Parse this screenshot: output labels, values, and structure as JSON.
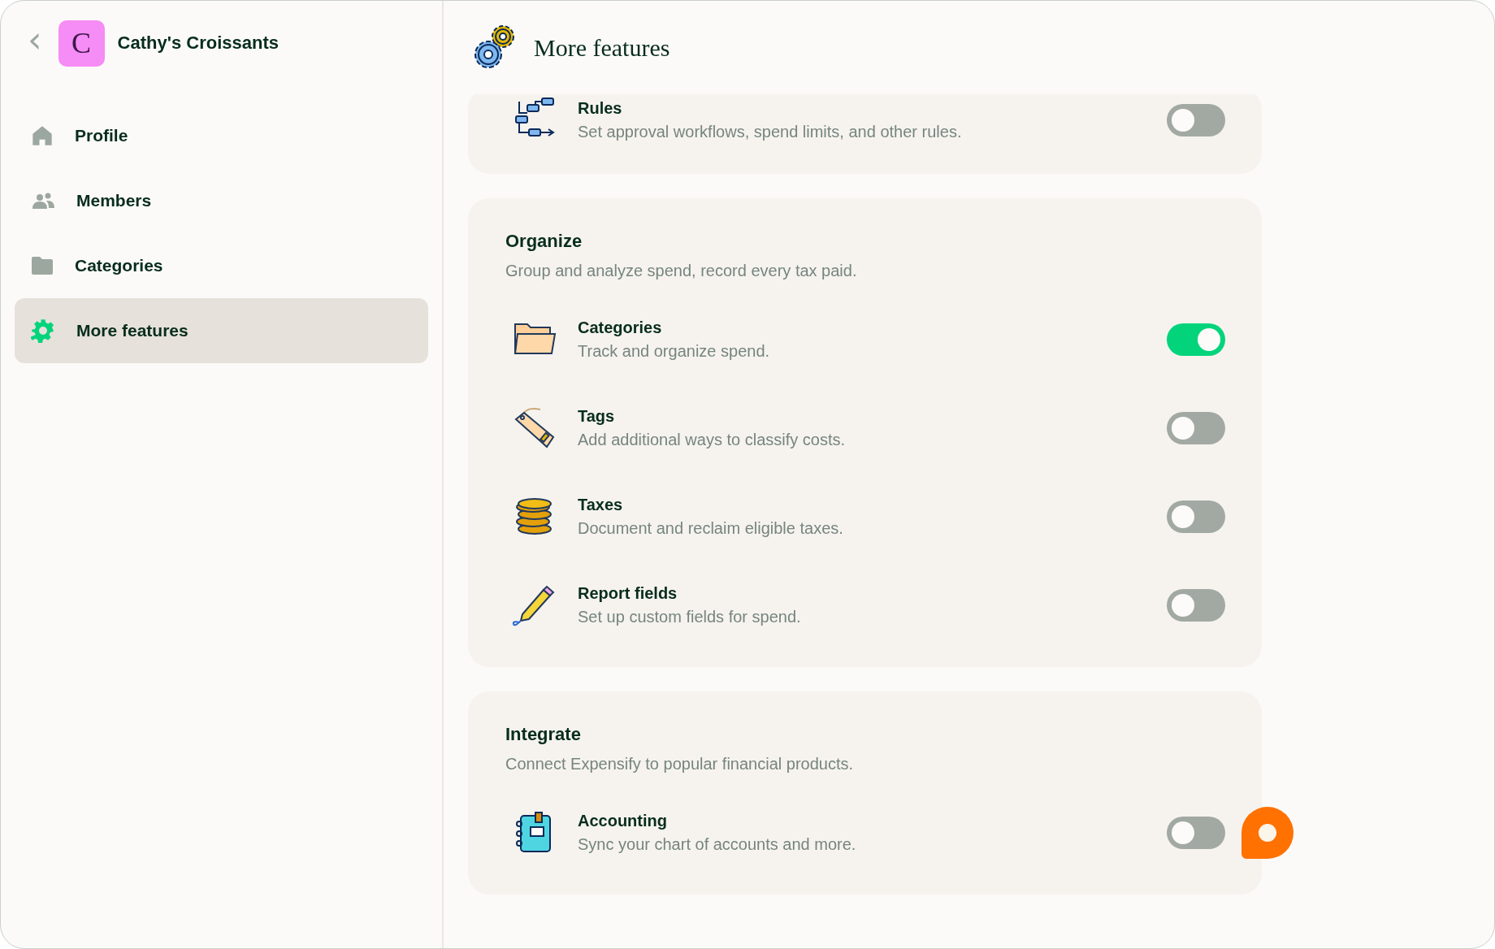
{
  "sidebar": {
    "back_label": "‹",
    "workspace": {
      "initial": "C",
      "name": "Cathy's Croissants"
    },
    "items": [
      {
        "label": "Profile",
        "selected": false
      },
      {
        "label": "Members",
        "selected": false
      },
      {
        "label": "Categories",
        "selected": false
      },
      {
        "label": "More features",
        "selected": true
      }
    ]
  },
  "header": {
    "title": "More features"
  },
  "sections": [
    {
      "features": [
        {
          "title": "Rules",
          "description": "Set approval workflows, spend limits, and other rules.",
          "on": false
        }
      ]
    },
    {
      "title": "Organize",
      "description": "Group and analyze spend, record every tax paid.",
      "features": [
        {
          "title": "Categories",
          "description": "Track and organize spend.",
          "on": true
        },
        {
          "title": "Tags",
          "description": "Add additional ways to classify costs.",
          "on": false
        },
        {
          "title": "Taxes",
          "description": "Document and reclaim eligible taxes.",
          "on": false
        },
        {
          "title": "Report fields",
          "description": "Set up custom fields for spend.",
          "on": false
        }
      ]
    },
    {
      "title": "Integrate",
      "description": "Connect Expensify to popular financial products.",
      "features": [
        {
          "title": "Accounting",
          "description": "Sync your chart of accounts and more.",
          "on": false
        }
      ]
    }
  ]
}
